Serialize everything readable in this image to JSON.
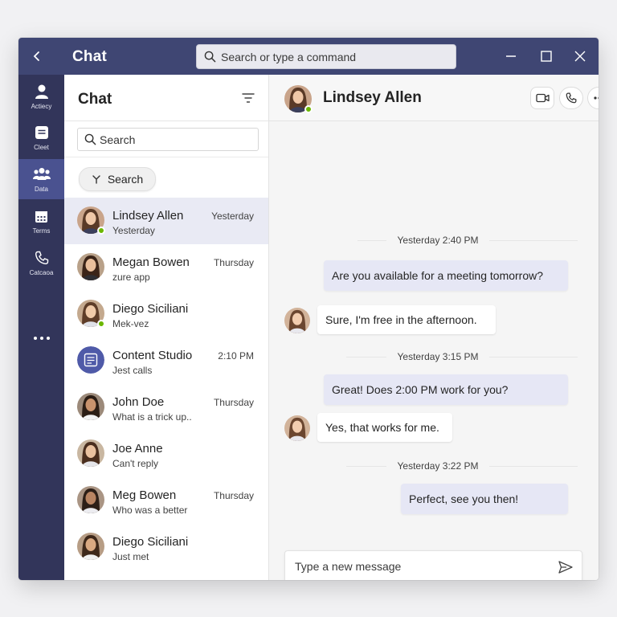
{
  "titlebar": {
    "title": "Chat",
    "search_placeholder": "Search or type a command"
  },
  "rail": {
    "items": [
      {
        "label": "Actiecy",
        "icon": "person-icon"
      },
      {
        "label": "Cleet",
        "icon": "chat-icon"
      },
      {
        "label": "Data",
        "icon": "teams-icon"
      },
      {
        "label": "Terms",
        "icon": "calendar-icon"
      },
      {
        "label": "Catcaoa",
        "icon": "phone-icon"
      }
    ],
    "active_index": 2
  },
  "chat_list": {
    "title": "Chat",
    "search_placeholder": "Search",
    "pill_label": "Search",
    "chats": [
      {
        "name": "Lindsey Allen",
        "preview": "Yesterday",
        "time": "Yesterday",
        "selected": true,
        "online": true
      },
      {
        "name": "Megan Bowen",
        "preview": "zure app",
        "time": "Thursday",
        "selected": false,
        "online": false
      },
      {
        "name": "Diego Siciliani",
        "preview": "Mek-vez",
        "time": "",
        "selected": false,
        "online": true
      },
      {
        "name": "Content Studio",
        "preview": "Jest calls",
        "time": "2:10 PM",
        "selected": false,
        "online": false
      },
      {
        "name": "John Doe",
        "preview": "What is a trick up..",
        "time": "Thursday",
        "selected": false,
        "online": false
      },
      {
        "name": "Joe Anne",
        "preview": "Can't reply",
        "time": "",
        "selected": false,
        "online": false
      },
      {
        "name": "Meg Bowen",
        "preview": "Who was a better",
        "time": "Thursday",
        "selected": false,
        "online": false
      },
      {
        "name": "Diego Siciliani",
        "preview": "Just met",
        "time": "",
        "selected": false,
        "online": false
      }
    ]
  },
  "conversation": {
    "contact_name": "Lindsey Allen",
    "messages": [
      {
        "timestamp": "Yesterday 2:40 PM",
        "from": "me",
        "text": "Are you available for a meeting tomorrow?"
      },
      {
        "from": "them",
        "text": "Sure, I'm free in the afternoon."
      },
      {
        "timestamp": "Yesterday 3:15 PM",
        "from": "me",
        "text": "Great! Does 2:00 PM work for you?"
      },
      {
        "from": "them",
        "text": "Yes, that works for me."
      },
      {
        "timestamp": "Yesterday 3:22 PM",
        "from": "me",
        "text": "Perfect, see you then!"
      }
    ],
    "compose_placeholder": "Type a new message"
  },
  "colors": {
    "titlebar": "#3f4673",
    "rail": "#32355a",
    "rail_active": "#4a5290",
    "my_bubble": "#e6e7f5",
    "selected_chat": "#e9eaf4",
    "presence": "#6bb700"
  }
}
